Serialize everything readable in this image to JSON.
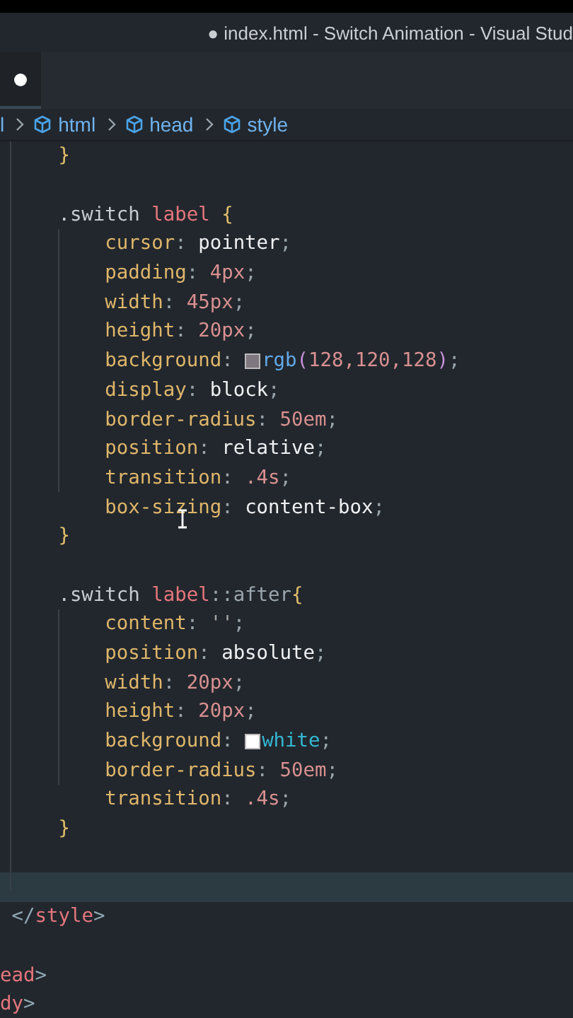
{
  "window": {
    "title": "● index.html - Switch Animation - Visual Stud"
  },
  "tab": {
    "modified": true
  },
  "breadcrumb": [
    {
      "text": "l",
      "icon": false
    },
    {
      "text": "html",
      "icon": true
    },
    {
      "text": "head",
      "icon": true
    },
    {
      "text": "style",
      "icon": true
    }
  ],
  "lines": [
    {
      "kind": "code",
      "text": "     }"
    },
    {
      "kind": "blank"
    },
    {
      "kind": "code",
      "text": "     .switch label {"
    },
    {
      "kind": "code",
      "text": "         cursor: pointer;"
    },
    {
      "kind": "code",
      "text": "         padding: 4px;"
    },
    {
      "kind": "code",
      "text": "         width: 45px;"
    },
    {
      "kind": "code",
      "text": "         height: 20px;"
    },
    {
      "kind": "code",
      "text": "         background: rgb(128,120,128);",
      "color": "#807880"
    },
    {
      "kind": "code",
      "text": "         display: block;"
    },
    {
      "kind": "code",
      "text": "         border-radius: 50em;"
    },
    {
      "kind": "code",
      "text": "         position: relative;"
    },
    {
      "kind": "code",
      "text": "         transition: .4s;"
    },
    {
      "kind": "code",
      "text": "         box-sizing: content-box;"
    },
    {
      "kind": "code",
      "text": "     }"
    },
    {
      "kind": "blank"
    },
    {
      "kind": "code",
      "text": "     .switch label::after{"
    },
    {
      "kind": "code",
      "text": "         content: '';"
    },
    {
      "kind": "code",
      "text": "         position: absolute;"
    },
    {
      "kind": "code",
      "text": "         width: 20px;"
    },
    {
      "kind": "code",
      "text": "         height: 20px;"
    },
    {
      "kind": "code",
      "text": "         background: white;",
      "color": "#ffffff"
    },
    {
      "kind": "code",
      "text": "         border-radius: 50em;"
    },
    {
      "kind": "code",
      "text": "         transition: .4s;"
    },
    {
      "kind": "code",
      "text": "     }"
    },
    {
      "kind": "blank"
    },
    {
      "kind": "current"
    },
    {
      "kind": "code",
      "text": " </style>"
    },
    {
      "kind": "blank"
    },
    {
      "kind": "code",
      "text": "ead>"
    },
    {
      "kind": "code",
      "text": "dy>"
    }
  ]
}
